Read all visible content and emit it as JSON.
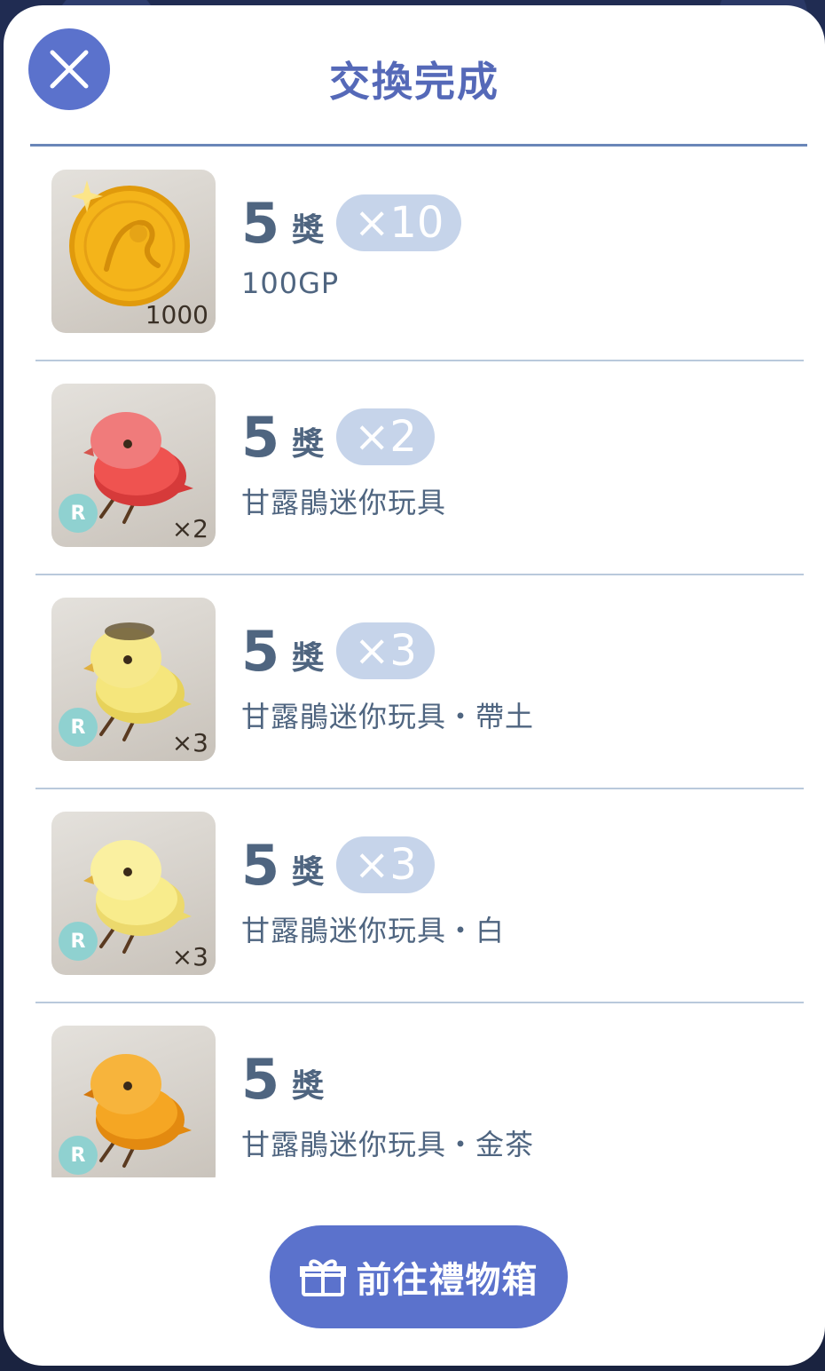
{
  "dialog": {
    "title": "交換完成",
    "close_icon": "close-x-icon"
  },
  "items": [
    {
      "count": "5",
      "unit": "獎",
      "multiplier": "×10",
      "name": "100GP",
      "thumb_label": "1000",
      "rarity": "",
      "icon": "gold-coin-icon",
      "colors": {
        "body": "#f4b41a",
        "shade": "#e09a0c"
      }
    },
    {
      "count": "5",
      "unit": "獎",
      "multiplier": "×2",
      "name": "甘露鵑迷你玩具",
      "thumb_label": "×2",
      "rarity": "R",
      "icon": "red-bird-toy-icon",
      "colors": {
        "body": "#ef5350",
        "shade": "#d63a3a",
        "head": "#f07b7b"
      }
    },
    {
      "count": "5",
      "unit": "獎",
      "multiplier": "×3",
      "name": "甘露鵑迷你玩具・帶土",
      "thumb_label": "×3",
      "rarity": "R",
      "icon": "yellow-bird-toy-dirty-icon",
      "colors": {
        "body": "#f5e67c",
        "shade": "#e7d25a",
        "head": "#f6e88a"
      }
    },
    {
      "count": "5",
      "unit": "獎",
      "multiplier": "×3",
      "name": "甘露鵑迷你玩具・白",
      "thumb_label": "×3",
      "rarity": "R",
      "icon": "pale-yellow-bird-toy-icon",
      "colors": {
        "body": "#f8ec8c",
        "shade": "#ecd96c",
        "head": "#faf0a0"
      }
    },
    {
      "count": "5",
      "unit": "獎",
      "multiplier": "",
      "name": "甘露鵑迷你玩具・金茶",
      "thumb_label": "",
      "rarity": "R",
      "icon": "orange-bird-toy-icon",
      "colors": {
        "body": "#f5a623",
        "shade": "#e38a10",
        "head": "#f7b43c"
      }
    }
  ],
  "footer": {
    "gift_button_label": "前往禮物箱",
    "gift_icon": "gift-box-icon"
  },
  "theme": {
    "accent": "#5b72cc",
    "text": "#4f6580",
    "badge_bg": "#c6d4ea",
    "rarity_bg": "#8fd1d0"
  }
}
